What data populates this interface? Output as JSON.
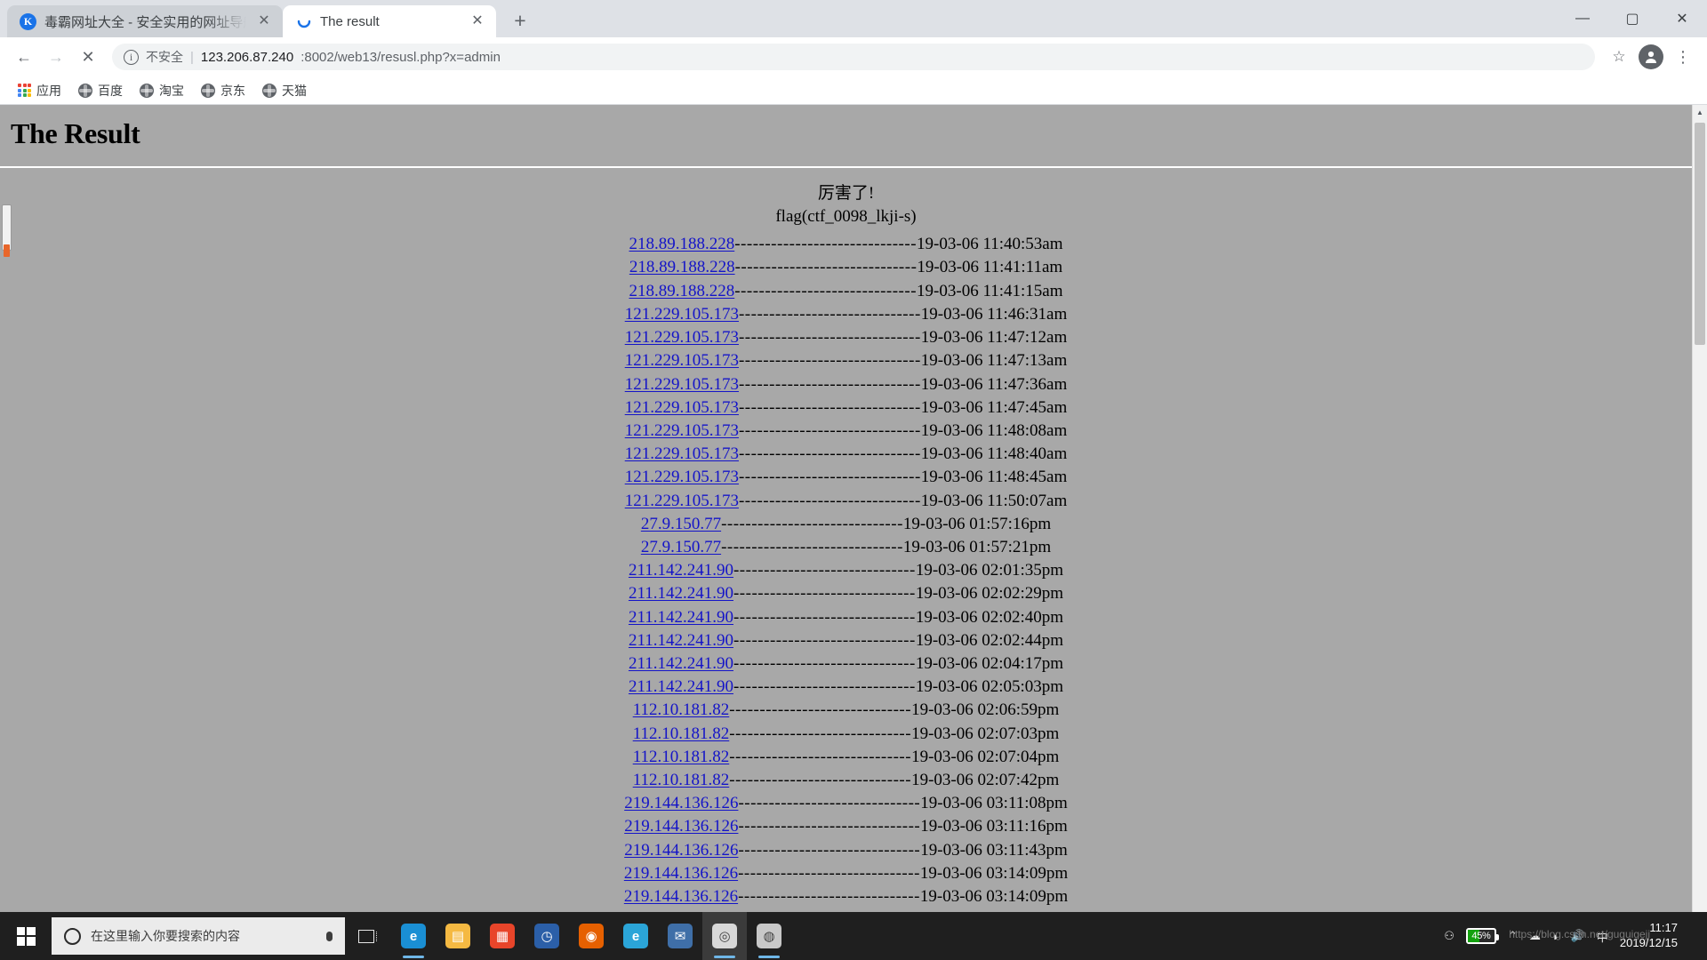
{
  "browser": {
    "tabs": [
      {
        "title": "毒霸网址大全 - 安全实用的网址导航",
        "favicon": "kingsoft-k-icon",
        "active": false,
        "close_label": "✕"
      },
      {
        "title": "The result",
        "favicon": "loading-spinner-icon",
        "active": true,
        "close_label": "✕"
      }
    ],
    "new_tab_label": "+",
    "window_controls": {
      "minimize": "—",
      "maximize": "▢",
      "close": "✕"
    },
    "nav": {
      "back": "←",
      "forward": "→",
      "stop": "✕"
    },
    "omnibox": {
      "security_label": "不安全",
      "info_glyph": "ⓘ",
      "separator": "|",
      "url_main": "123.206.87.240",
      "url_rest": ":8002/web13/resusl.php?x=admin",
      "star_glyph": "☆"
    },
    "menu_glyph": "⋮",
    "bookmarks": [
      {
        "label": "应用",
        "icon": "apps-grid-icon"
      },
      {
        "label": "百度",
        "icon": "globe-icon"
      },
      {
        "label": "淘宝",
        "icon": "globe-icon"
      },
      {
        "label": "京东",
        "icon": "globe-icon"
      },
      {
        "label": "天猫",
        "icon": "globe-icon"
      }
    ]
  },
  "page": {
    "title": "The Result",
    "message": "厉害了!",
    "flag": "flag(ctf_0098_lkji-s)",
    "dashes": "------------------------------",
    "rows": [
      {
        "ip": "218.89.188.228",
        "time": "19-03-06 11:40:53am"
      },
      {
        "ip": "218.89.188.228",
        "time": "19-03-06 11:41:11am"
      },
      {
        "ip": "218.89.188.228",
        "time": "19-03-06 11:41:15am"
      },
      {
        "ip": "121.229.105.173",
        "time": "19-03-06 11:46:31am"
      },
      {
        "ip": "121.229.105.173",
        "time": "19-03-06 11:47:12am"
      },
      {
        "ip": "121.229.105.173",
        "time": "19-03-06 11:47:13am"
      },
      {
        "ip": "121.229.105.173",
        "time": "19-03-06 11:47:36am"
      },
      {
        "ip": "121.229.105.173",
        "time": "19-03-06 11:47:45am"
      },
      {
        "ip": "121.229.105.173",
        "time": "19-03-06 11:48:08am"
      },
      {
        "ip": "121.229.105.173",
        "time": "19-03-06 11:48:40am"
      },
      {
        "ip": "121.229.105.173",
        "time": "19-03-06 11:48:45am"
      },
      {
        "ip": "121.229.105.173",
        "time": "19-03-06 11:50:07am"
      },
      {
        "ip": "27.9.150.77",
        "time": "19-03-06 01:57:16pm"
      },
      {
        "ip": "27.9.150.77",
        "time": "19-03-06 01:57:21pm"
      },
      {
        "ip": "211.142.241.90",
        "time": "19-03-06 02:01:35pm"
      },
      {
        "ip": "211.142.241.90",
        "time": "19-03-06 02:02:29pm"
      },
      {
        "ip": "211.142.241.90",
        "time": "19-03-06 02:02:40pm"
      },
      {
        "ip": "211.142.241.90",
        "time": "19-03-06 02:02:44pm"
      },
      {
        "ip": "211.142.241.90",
        "time": "19-03-06 02:04:17pm"
      },
      {
        "ip": "211.142.241.90",
        "time": "19-03-06 02:05:03pm"
      },
      {
        "ip": "112.10.181.82",
        "time": "19-03-06 02:06:59pm"
      },
      {
        "ip": "112.10.181.82",
        "time": "19-03-06 02:07:03pm"
      },
      {
        "ip": "112.10.181.82",
        "time": "19-03-06 02:07:04pm"
      },
      {
        "ip": "112.10.181.82",
        "time": "19-03-06 02:07:42pm"
      },
      {
        "ip": "219.144.136.126",
        "time": "19-03-06 03:11:08pm"
      },
      {
        "ip": "219.144.136.126",
        "time": "19-03-06 03:11:16pm"
      },
      {
        "ip": "219.144.136.126",
        "time": "19-03-06 03:11:43pm"
      },
      {
        "ip": "219.144.136.126",
        "time": "19-03-06 03:14:09pm"
      },
      {
        "ip": "219.144.136.126",
        "time": "19-03-06 03:14:09pm"
      }
    ],
    "colors": {
      "background": "#a8a8a8",
      "link": "#1414c8",
      "text": "#000000"
    }
  },
  "scrollbar": {
    "up_arrow": "▲",
    "down_arrow": "▼"
  },
  "taskbar": {
    "start_label": "Start",
    "search_placeholder": "在这里输入你要搜索的内容",
    "apps": [
      {
        "name": "edge",
        "glyph": "e",
        "color": "#1a8fd4",
        "running": true,
        "active": false
      },
      {
        "name": "file-explorer",
        "glyph": "▤",
        "color": "#f5b942",
        "running": false,
        "active": false
      },
      {
        "name": "microsoft-store",
        "glyph": "▦",
        "color": "#e8452a",
        "running": false,
        "active": false
      },
      {
        "name": "clock",
        "glyph": "◷",
        "color": "#2b5fa8",
        "running": false,
        "active": false
      },
      {
        "name": "firefox",
        "glyph": "◉",
        "color": "#e66000",
        "running": false,
        "active": false
      },
      {
        "name": "edge-legacy",
        "glyph": "e",
        "color": "#2ba5d8",
        "running": false,
        "active": false
      },
      {
        "name": "mail",
        "glyph": "✉",
        "color": "#3f6fa8",
        "running": false,
        "active": false
      },
      {
        "name": "chrome",
        "glyph": "◎",
        "color": "#d8d8d8",
        "running": true,
        "active": true
      },
      {
        "name": "browser-other",
        "glyph": "◍",
        "color": "#c8c8c8",
        "running": true,
        "active": false
      }
    ],
    "tray": {
      "battery_percent": "45%",
      "battery_level": 45,
      "people_glyph": "⚇",
      "onedrive_glyph": "☁",
      "wifi_glyph": "◗",
      "volume_glyph": "🔊",
      "ime_glyph": "中",
      "time": "11:17",
      "date": "2019/12/15"
    }
  },
  "watermark": "https://blog.csdn.net/guguigeji"
}
